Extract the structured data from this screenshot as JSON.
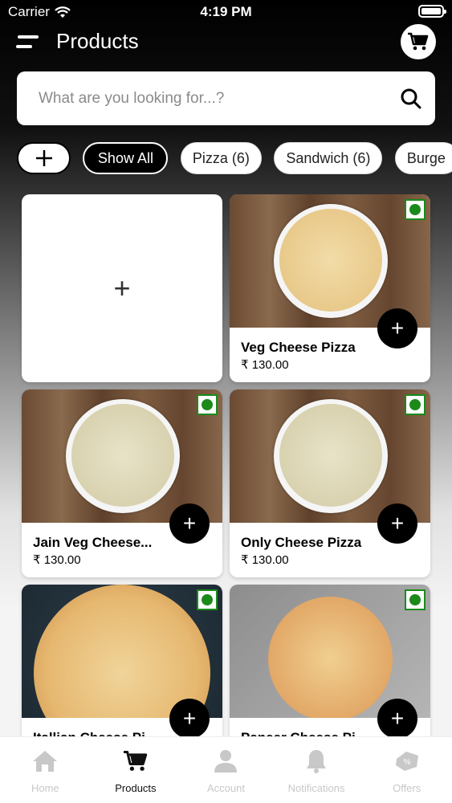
{
  "status_bar": {
    "carrier": "Carrier",
    "time": "4:19 PM"
  },
  "header": {
    "title": "Products"
  },
  "search": {
    "placeholder": "What are you looking for...?"
  },
  "chips": [
    {
      "label": "+"
    },
    {
      "label": "Show All"
    },
    {
      "label": "Pizza (6)"
    },
    {
      "label": "Sandwich (6)"
    },
    {
      "label": "Burge"
    }
  ],
  "products": [
    {
      "name": "Veg Cheese Pizza",
      "price": "₹ 130.00"
    },
    {
      "name": "Jain Veg Cheese...",
      "price": "₹ 130.00"
    },
    {
      "name": "Only Cheese Pizza",
      "price": "₹ 130.00"
    },
    {
      "name": "Itallian Cheese Pi",
      "price": ""
    },
    {
      "name": "Paneer Cheese Pi",
      "price": ""
    }
  ],
  "add_card": {
    "label": "+"
  },
  "add_button_label": "+",
  "tabs": [
    {
      "label": "Home",
      "icon": "home-icon"
    },
    {
      "label": "Products",
      "icon": "cart-icon"
    },
    {
      "label": "Account",
      "icon": "person-icon"
    },
    {
      "label": "Notifications",
      "icon": "bell-icon"
    },
    {
      "label": "Offers",
      "icon": "offer-tag-icon"
    }
  ],
  "active_tab": "Products",
  "colors": {
    "veg_indicator": "#1b8a1b",
    "accent": "#000000"
  }
}
